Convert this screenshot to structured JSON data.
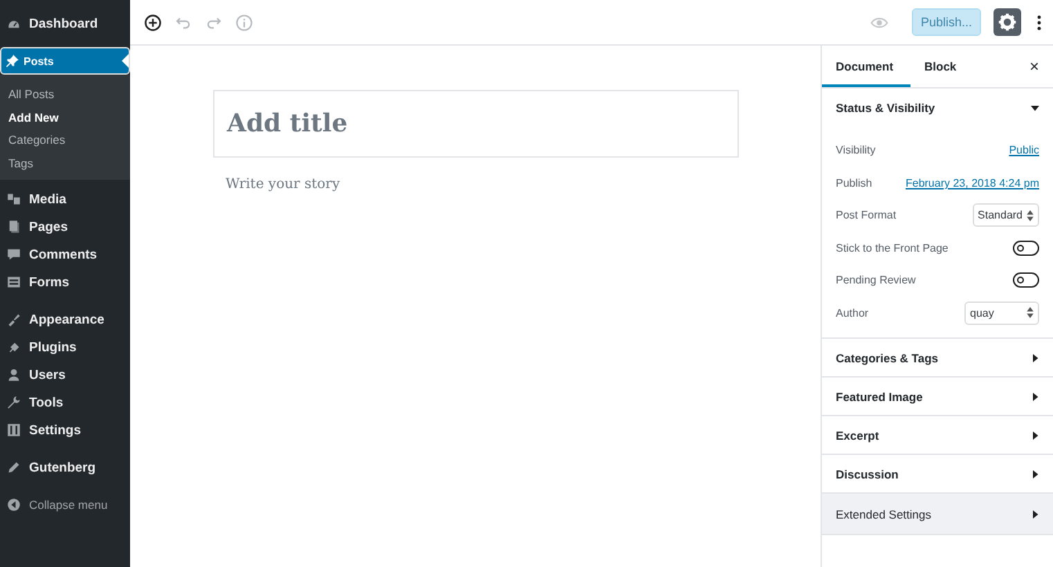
{
  "admin_menu": {
    "groups": [
      {
        "items": [
          {
            "label": "Dashboard",
            "selected": false
          },
          {
            "label": "Posts",
            "selected": true,
            "submenu": [
              {
                "label": "All Posts",
                "selected": false
              },
              {
                "label": "Add New",
                "selected": true
              },
              {
                "label": "Categories",
                "selected": false
              },
              {
                "label": "Tags",
                "selected": false
              }
            ]
          },
          {
            "label": "Media",
            "selected": false
          },
          {
            "label": "Pages",
            "selected": false
          },
          {
            "label": "Comments",
            "selected": false
          },
          {
            "label": "Forms",
            "selected": false
          }
        ]
      },
      {
        "items": [
          {
            "label": "Appearance",
            "selected": false
          },
          {
            "label": "Plugins",
            "selected": false
          },
          {
            "label": "Users",
            "selected": false
          },
          {
            "label": "Tools",
            "selected": false
          },
          {
            "label": "Settings",
            "selected": false
          }
        ]
      },
      {
        "items": [
          {
            "label": "Gutenberg",
            "selected": false
          }
        ]
      }
    ],
    "collapse": "Collapse menu"
  },
  "toolbar": {
    "publish": {
      "label": "Publish...",
      "disabled": true
    },
    "settings_on": true
  },
  "editor": {
    "title_placeholder": "Add title",
    "body_placeholder": "Write your story"
  },
  "settings_sidebar": {
    "tabs": [
      {
        "label": "Document",
        "selected": true
      },
      {
        "label": "Block",
        "selected": false
      }
    ],
    "close": "×",
    "panels": [
      {
        "title": "Status & Visibility",
        "expanded": true,
        "hovered": false,
        "rows": [
          {
            "kind": "link",
            "label": "Visibility",
            "value": "Public"
          },
          {
            "kind": "link",
            "label": "Publish",
            "value": "February 23, 2018 4:24 pm"
          },
          {
            "kind": "select",
            "label": "Post Format",
            "value": "Standard"
          },
          {
            "kind": "toggle",
            "label": "Stick to the Front Page",
            "on": false
          },
          {
            "kind": "toggle",
            "label": "Pending Review",
            "on": false
          },
          {
            "kind": "select",
            "label": "Author",
            "value": "quay"
          }
        ]
      },
      {
        "title": "Categories & Tags",
        "expanded": false,
        "hovered": false
      },
      {
        "title": "Featured Image",
        "expanded": false,
        "hovered": false
      },
      {
        "title": "Excerpt",
        "expanded": false,
        "hovered": false
      },
      {
        "title": "Discussion",
        "expanded": false,
        "hovered": false
      },
      {
        "title": "Extended Settings",
        "expanded": false,
        "hovered": true
      }
    ]
  }
}
